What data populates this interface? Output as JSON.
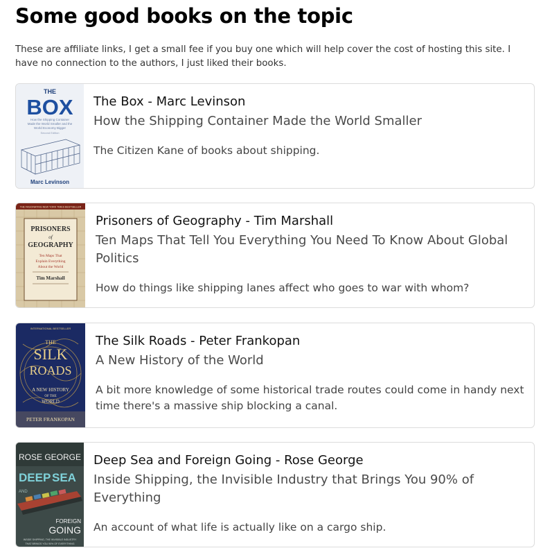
{
  "page": {
    "heading": "Some good books on the topic",
    "intro": "These are affiliate links, I get a small fee if you buy one which will help cover the cost of hosting this site. I have no connection to the authors, I just liked their books."
  },
  "books": [
    {
      "title": "The Box - Marc Levinson",
      "subtitle": "How the Shipping Container Made the World Smaller",
      "description": "The Citizen Kane of books about shipping.",
      "cover": {
        "title_top": "THE",
        "title_main": "BOX",
        "tagline_1": "How the Shipping Container",
        "tagline_2": "Made the World Smaller and the",
        "tagline_3": "World Economy Bigger",
        "edition": "Second Edition",
        "author": "Marc Levinson"
      }
    },
    {
      "title": "Prisoners of Geography - Tim Marshall",
      "subtitle": "Ten Maps That Tell You Everything You Need To Know About Global Politics",
      "description": "How do things like shipping lanes affect who goes to war with whom?",
      "cover": {
        "banner": "THE FASCINATING NEW YORK TIMES BESTSELLER",
        "title_1": "PRISONERS",
        "title_2": "of",
        "title_3": "GEOGRAPHY",
        "tagline_1": "Ten Maps That",
        "tagline_2": "Explain Everything",
        "tagline_3": "About the World",
        "author": "Tim Marshall"
      }
    },
    {
      "title": "The Silk Roads - Peter Frankopan",
      "subtitle": "A New History of the World",
      "description": "A bit more knowledge of some historical trade routes could come in handy next time there's a massive ship blocking a canal.",
      "cover": {
        "banner": "INTERNATIONAL BESTSELLER",
        "title_1": "THE",
        "title_2": "SILK",
        "title_3": "ROADS",
        "tagline_1": "A NEW HISTORY",
        "tagline_2": "OF THE",
        "tagline_3": "WORLD",
        "author": "PETER FRANKOPAN"
      }
    },
    {
      "title": "Deep Sea and Foreign Going - Rose George",
      "subtitle": "Inside Shipping, the Invisible Industry that Brings You 90% of Everything",
      "description": "An account of what life is actually like on a cargo ship.",
      "cover": {
        "author": "ROSE GEORGE",
        "title_1": "DEEP",
        "title_2": "SEA",
        "title_3": "AND",
        "title_4": "FOREIGN",
        "title_5": "GOING",
        "tagline_1": "INSIDE SHIPPING, THE INVISIBLE INDUSTRY",
        "tagline_2": "THAT BRINGS YOU 90% OF EVERYTHING"
      }
    }
  ]
}
